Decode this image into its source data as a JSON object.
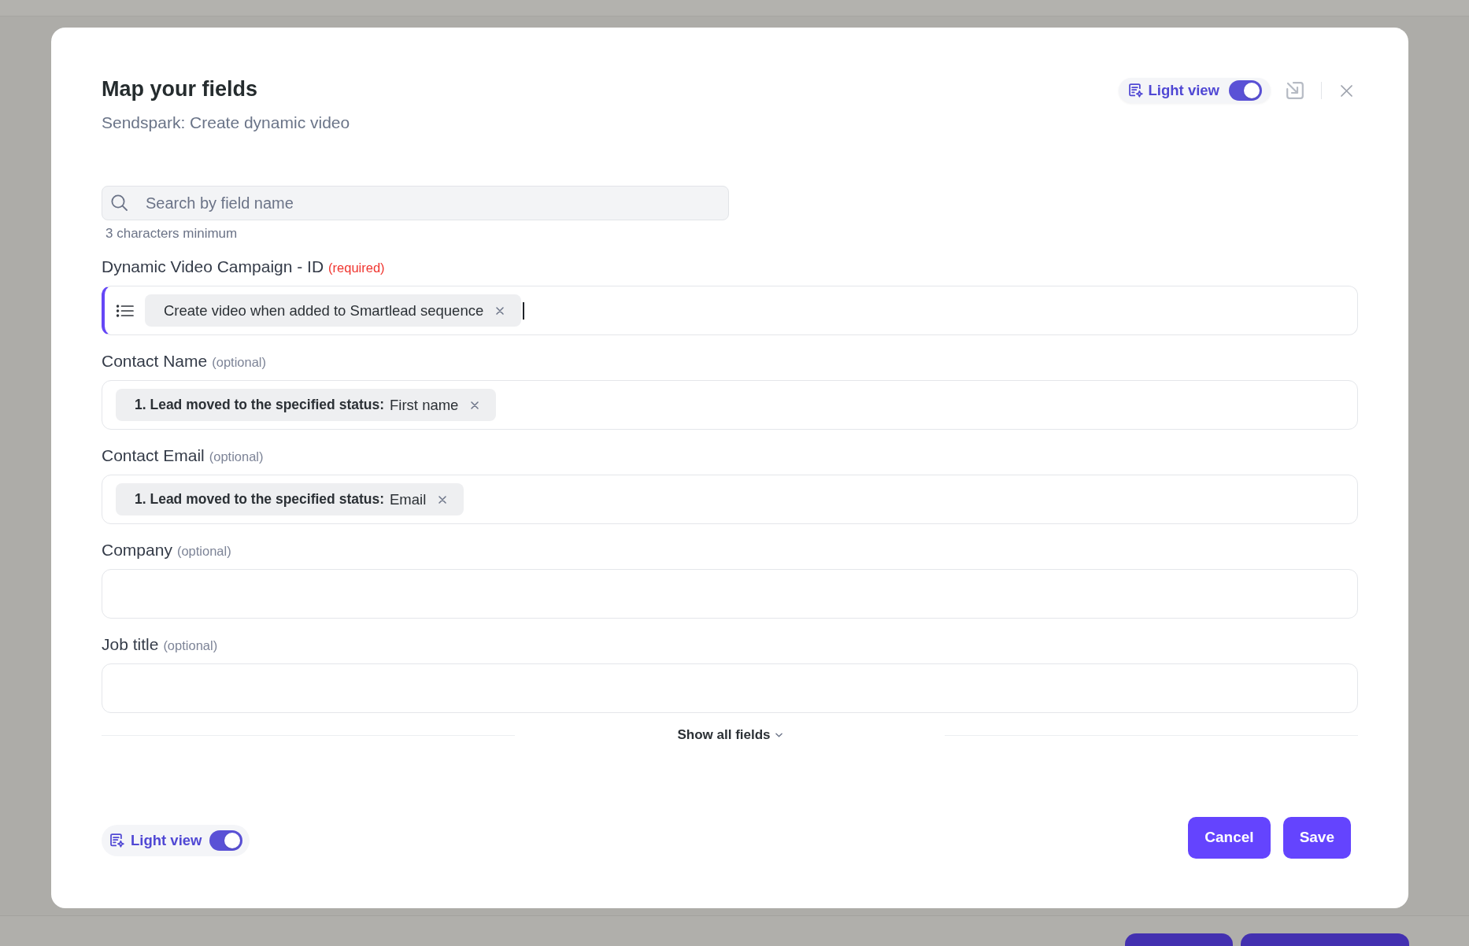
{
  "dialog": {
    "title": "Map your fields",
    "subtitle": "Sendspark: Create dynamic video"
  },
  "header_toggle": {
    "label": "Light view",
    "on": true
  },
  "search": {
    "placeholder": "Search by field name",
    "hint": "3 characters minimum"
  },
  "fields": [
    {
      "label": "Dynamic Video Campaign - ID",
      "tag": "(required)",
      "required": true,
      "kind": "dropdown",
      "focused": true,
      "chips": [
        {
          "value": "Create video when added to Smartlead sequence"
        }
      ]
    },
    {
      "label": "Contact Name",
      "tag": "(optional)",
      "required": false,
      "kind": "text",
      "focused": false,
      "chips": [
        {
          "source": "1. Lead moved to the specified status:",
          "value": "First name"
        }
      ]
    },
    {
      "label": "Contact Email",
      "tag": "(optional)",
      "required": false,
      "kind": "text",
      "focused": false,
      "chips": [
        {
          "source": "1. Lead moved to the specified status:",
          "value": "Email"
        }
      ]
    },
    {
      "label": "Company",
      "tag": "(optional)",
      "required": false,
      "kind": "text",
      "focused": false
    },
    {
      "label": "Job title",
      "tag": "(optional)",
      "required": false,
      "kind": "text",
      "focused": false
    }
  ],
  "show_all": {
    "label": "Show all fields"
  },
  "footer": {
    "toggle": {
      "label": "Light view",
      "on": true
    },
    "buttons": [
      "Cancel",
      "Save"
    ]
  }
}
